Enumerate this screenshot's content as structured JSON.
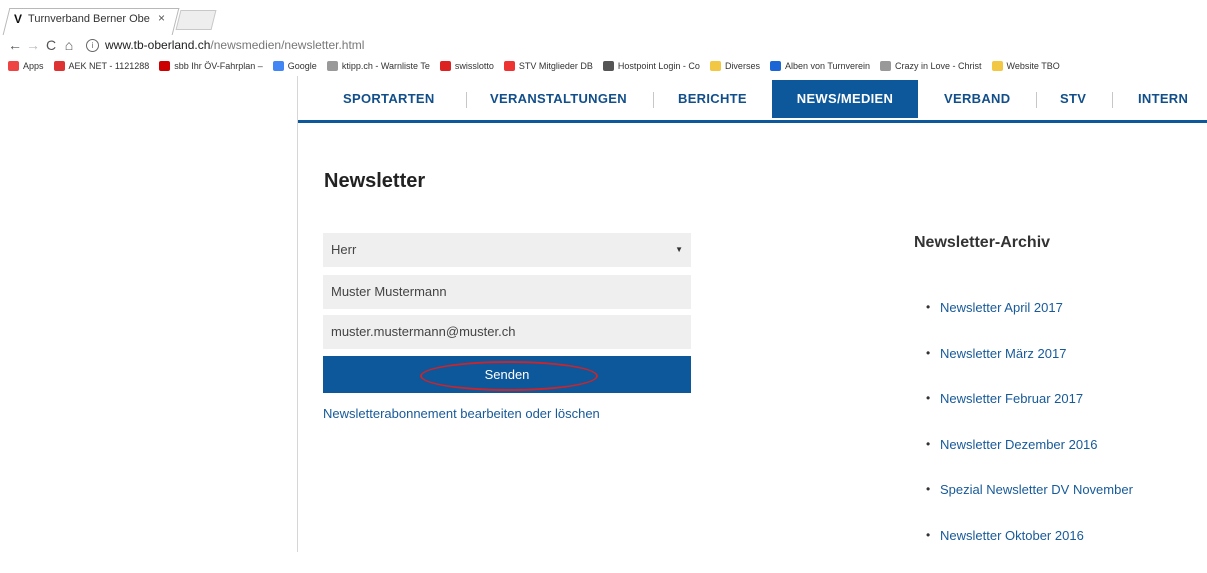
{
  "browser": {
    "tab_title": "Turnverband Berner Obe",
    "tab_close": "×",
    "url_host": "www.tb-oberland.ch",
    "url_path": "/newsmedien/newsletter.html",
    "bookmarks": [
      {
        "label": "Apps",
        "color": "#e44"
      },
      {
        "label": "AEK NET - 1121288",
        "color": "#d33"
      },
      {
        "label": "sbb Ihr ÖV-Fahrplan –",
        "color": "#c00"
      },
      {
        "label": "Google",
        "color": "#4285f4"
      },
      {
        "label": "ktipp.ch - Warnliste Te",
        "color": "#999"
      },
      {
        "label": "swisslotto",
        "color": "#d22"
      },
      {
        "label": "STV Mitglieder DB",
        "color": "#e33"
      },
      {
        "label": "Hostpoint Login - Co",
        "color": "#555"
      },
      {
        "label": "Diverses",
        "color": "#f2c744"
      },
      {
        "label": "Alben von Turnverein",
        "color": "#1a66d6"
      },
      {
        "label": "Crazy in Love - Christ",
        "color": "#999"
      },
      {
        "label": "Website TBO",
        "color": "#f2c744"
      }
    ]
  },
  "nav": {
    "items": [
      "SPORTARTEN",
      "VERANSTALTUNGEN",
      "BERICHTE",
      "NEWS/MEDIEN",
      "VERBAND",
      "STV",
      "INTERN"
    ],
    "active": "NEWS/MEDIEN"
  },
  "newsletter": {
    "title": "Newsletter",
    "salutation": "Herr",
    "name": "Muster Mustermann",
    "email": "muster.mustermann@muster.ch",
    "submit": "Senden",
    "edit_link": "Newsletterabonnement bearbeiten oder löschen"
  },
  "archive": {
    "title": "Newsletter-Archiv",
    "items": [
      "Newsletter April 2017",
      "Newsletter März 2017",
      "Newsletter Februar 2017",
      "Newsletter Dezember 2016",
      "Spezial Newsletter DV November",
      "Newsletter Oktober 2016"
    ]
  }
}
